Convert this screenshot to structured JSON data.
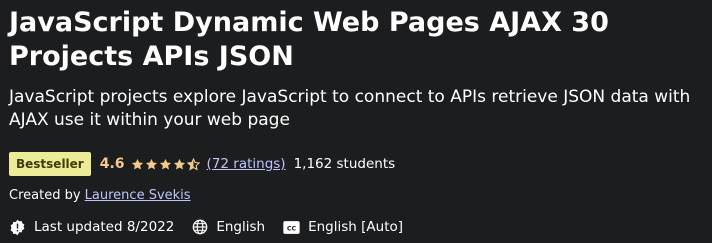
{
  "course": {
    "title": "JavaScript Dynamic Web Pages AJAX 30 Projects APIs JSON",
    "subtitle": "JavaScript projects explore JavaScript to connect to APIs retrieve JSON data with AJAX use it within your web page"
  },
  "rating": {
    "badge": "Bestseller",
    "score": "4.6",
    "stars_value": 4.6,
    "ratings_link": "(72 ratings)",
    "students": "1,162 students"
  },
  "creator": {
    "prefix": "Created by",
    "name": "Laurence Svekis"
  },
  "meta": {
    "last_updated": "Last updated 8/2022",
    "language": "English",
    "captions": "English [Auto]"
  },
  "colors": {
    "background": "#1c1d1f",
    "badge_bg": "#eceb98",
    "star": "#f3ca8c",
    "link": "#c0c4fc"
  },
  "icons": {
    "update": "alert-badge-icon",
    "language": "globe-icon",
    "captions": "closed-captions-icon",
    "stars": "star-icon"
  }
}
